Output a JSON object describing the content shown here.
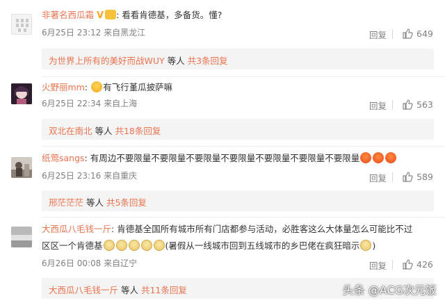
{
  "colors": {
    "username": "#eb7350",
    "meta": "#808080",
    "subbox_bg": "#f4f4f4"
  },
  "comments": [
    {
      "username": "非著名西瓜霜",
      "separator": ":",
      "text": "看看肯德基，多备货。懂?",
      "time": "6月25日 23:12",
      "location": "来自黑龙江",
      "reply_label": "回复",
      "likes": "649",
      "sub": {
        "name": "为世界上所有的美好而战WUY",
        "middle": " 等人 ",
        "count": "共3条回复"
      }
    },
    {
      "username": "火野丽mm",
      "separator": ":",
      "text": "有飞行堇瓜披萨嘛",
      "time": "6月25日 22:34",
      "location": "来自上海",
      "reply_label": "回复",
      "likes": "563",
      "sub": {
        "name": "双北在南北",
        "middle": " 等人 ",
        "count": "共18条回复"
      }
    },
    {
      "username": "纸莺sangs",
      "separator": ":",
      "text": " 有周边不要限量不要限量不要限量不要限量不要限量不要限量不要限量",
      "time": "6月25日 23:16",
      "location": "来自重庆",
      "reply_label": "回复",
      "likes": "589",
      "sub": {
        "name": "邢茫茫茫",
        "middle": " 等人 ",
        "count": "共5条回复"
      }
    },
    {
      "username": "大西瓜八毛钱一斤",
      "separator": ":",
      "text": " 肯德基全国所有城市所有门店都参与活动，必胜客这么大体量怎么可能比不过",
      "text2a": "区区一个肯德基",
      "text2b": "(暑假从一线城市回到五线城市的乡巴佬在疯狂暗示",
      "text2c": ")",
      "time": "6月26日 00:08",
      "location": "来自辽宁",
      "reply_label": "回复",
      "likes": "426",
      "sub": {
        "name": "大西瓜八毛钱一斤",
        "middle": " 等人 ",
        "count": "共11条回复"
      }
    }
  ],
  "watermark": "头条 @ACG次元饭"
}
